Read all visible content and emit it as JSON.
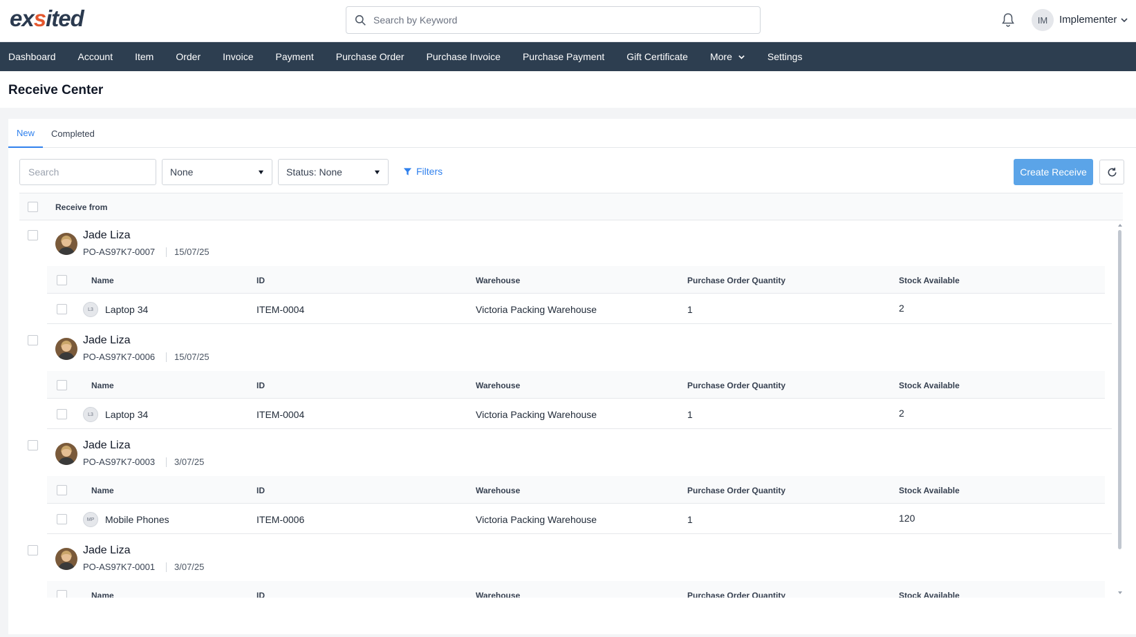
{
  "header": {
    "logo": {
      "pre": "ex",
      "accent": "s",
      "post": "ited"
    },
    "search_placeholder": "Search by Keyword",
    "user_initials": "IM",
    "user_name": "Implementer"
  },
  "nav": {
    "items": [
      "Dashboard",
      "Account",
      "Item",
      "Order",
      "Invoice",
      "Payment",
      "Purchase Order",
      "Purchase Invoice",
      "Purchase Payment",
      "Gift Certificate",
      "More",
      "Settings"
    ]
  },
  "page": {
    "title": "Receive Center"
  },
  "tabs": [
    "New",
    "Completed"
  ],
  "toolbar": {
    "search_placeholder": "Search",
    "select_1": "None",
    "select_2": "Status: None",
    "filters_label": "Filters",
    "create_label": "Create Receive"
  },
  "table": {
    "header": "Receive from",
    "sub_columns": [
      "Name",
      "ID",
      "Warehouse",
      "Purchase Order Quantity",
      "Stock Available"
    ],
    "groups": [
      {
        "name": "Jade Liza",
        "po": "PO-AS97K7-0007",
        "date": "15/07/25",
        "items": [
          {
            "badge": "L3",
            "name": "Laptop 34",
            "id": "ITEM-0004",
            "warehouse": "Victoria Packing Warehouse",
            "qty": "1",
            "stock": "2"
          }
        ]
      },
      {
        "name": "Jade Liza",
        "po": "PO-AS97K7-0006",
        "date": "15/07/25",
        "items": [
          {
            "badge": "L3",
            "name": "Laptop 34",
            "id": "ITEM-0004",
            "warehouse": "Victoria Packing Warehouse",
            "qty": "1",
            "stock": "2"
          }
        ]
      },
      {
        "name": "Jade Liza",
        "po": "PO-AS97K7-0003",
        "date": "3/07/25",
        "items": [
          {
            "badge": "MP",
            "name": "Mobile Phones",
            "id": "ITEM-0006",
            "warehouse": "Victoria Packing Warehouse",
            "qty": "1",
            "stock": "120"
          }
        ]
      },
      {
        "name": "Jade Liza",
        "po": "PO-AS97K7-0001",
        "date": "3/07/25",
        "items": []
      }
    ]
  },
  "colors": {
    "nav_bg": "#2d3e50",
    "accent": "#2f80ed",
    "button_bg": "#5ba4e8",
    "logo_dark": "#2b3a4f",
    "logo_accent": "#e4572e"
  },
  "icons": [
    "search-icon",
    "bell-icon",
    "chevron-down-icon",
    "caret-down-icon",
    "filter-icon",
    "refresh-icon"
  ]
}
